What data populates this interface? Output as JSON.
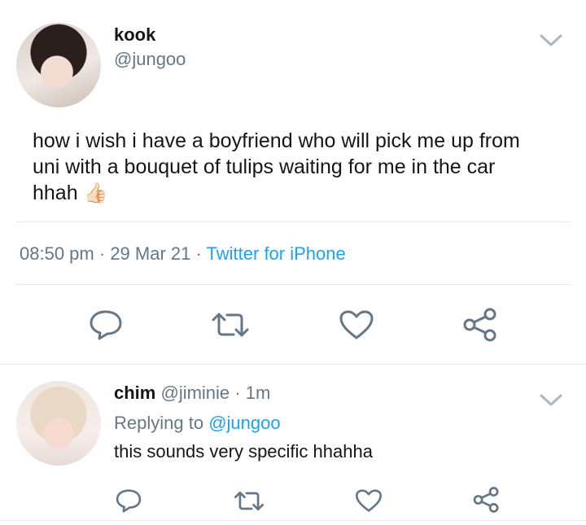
{
  "tweet": {
    "author_name": "kook",
    "author_handle": "@jungoo",
    "text_line1": "how i wish i have a boyfriend who will pick me up from",
    "text_line2": "uni with a bouquet of tulips waiting for me in the car",
    "text_line3": "hhah",
    "emoji": "👍🏻",
    "time": "08:50 pm",
    "sep1": "·",
    "date": "29 Mar 21",
    "sep2": "·",
    "source": "Twitter for iPhone"
  },
  "reply": {
    "author_name": "chim",
    "author_handle": "@jiminie",
    "sep": "·",
    "age": "1m",
    "replying_label": "Replying to",
    "replying_handle": "@jungoo",
    "text": "this sounds very specific hhahha"
  },
  "icons": {
    "reply": "reply-icon",
    "retweet": "retweet-icon",
    "like": "heart-icon",
    "share": "share-icon",
    "more": "chevron-down-icon"
  },
  "colors": {
    "text": "#14171a",
    "secondary": "#657786",
    "link": "#1da1f2",
    "divider": "#e1e8ed",
    "icon": "#657786"
  }
}
